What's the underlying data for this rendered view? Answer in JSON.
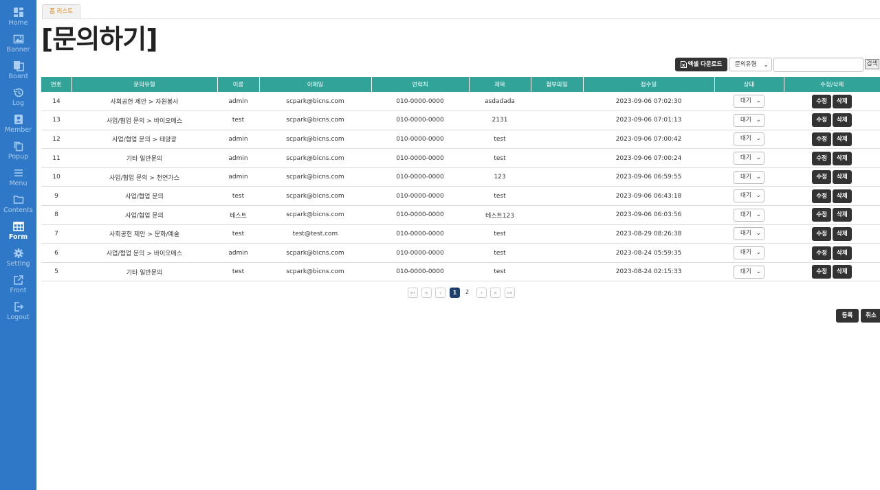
{
  "sidebar": {
    "items": [
      {
        "label": "Home",
        "icon": "dashboard-icon"
      },
      {
        "label": "Banner",
        "icon": "image-icon"
      },
      {
        "label": "Board",
        "icon": "board-icon"
      },
      {
        "label": "Log",
        "icon": "history-icon"
      },
      {
        "label": "Member",
        "icon": "member-icon"
      },
      {
        "label": "Popup",
        "icon": "copy-icon"
      },
      {
        "label": "Menu",
        "icon": "list-icon"
      },
      {
        "label": "Contents",
        "icon": "folder-icon"
      },
      {
        "label": "Form",
        "icon": "table-icon",
        "active": true
      },
      {
        "label": "Setting",
        "icon": "gear-icon"
      },
      {
        "label": "Front",
        "icon": "external-link-icon"
      },
      {
        "label": "Logout",
        "icon": "logout-icon"
      }
    ]
  },
  "tab": {
    "label": "폼 리스트"
  },
  "page": {
    "title": "[문의하기]"
  },
  "toolbar": {
    "excel_label": "엑셀 다운로드",
    "type_select": "문의유형",
    "search_value": "",
    "search_label": "검색"
  },
  "table": {
    "headers": [
      "번호",
      "문의유형",
      "이름",
      "이메일",
      "연락처",
      "제목",
      "첨부파일",
      "접수일",
      "상태",
      "수정/삭제"
    ],
    "rows": [
      {
        "no": "14",
        "type": "사회공헌 제안 > 자원봉사",
        "name": "admin",
        "email": "scpark@bicns.com",
        "phone": "010-0000-0000",
        "subject": "asdadada",
        "file": "",
        "date": "2023-09-06 07:02:30",
        "status": "대기"
      },
      {
        "no": "13",
        "type": "사업/협업 문의 > 바이오메스",
        "name": "test",
        "email": "scpark@bicns.com",
        "phone": "010-0000-0000",
        "subject": "2131",
        "file": "",
        "date": "2023-09-06 07:01:13",
        "status": "대기"
      },
      {
        "no": "12",
        "type": "사업/협업 문의 > 태양광",
        "name": "admin",
        "email": "scpark@bicns.com",
        "phone": "010-0000-0000",
        "subject": "test",
        "file": "",
        "date": "2023-09-06 07:00:42",
        "status": "대기"
      },
      {
        "no": "11",
        "type": "기타 일반문의",
        "name": "admin",
        "email": "scpark@bicns.com",
        "phone": "010-0000-0000",
        "subject": "test",
        "file": "",
        "date": "2023-09-06 07:00:24",
        "status": "대기"
      },
      {
        "no": "10",
        "type": "사업/협업 문의 > 천연가스",
        "name": "admin",
        "email": "scpark@bicns.com",
        "phone": "010-0000-0000",
        "subject": "123",
        "file": "",
        "date": "2023-09-06 06:59:55",
        "status": "대기"
      },
      {
        "no": "9",
        "type": "사업/협업 문의",
        "name": "test",
        "email": "scpark@bicns.com",
        "phone": "010-0000-0000",
        "subject": "test",
        "file": "",
        "date": "2023-09-06 06:43:18",
        "status": "대기"
      },
      {
        "no": "8",
        "type": "사업/협업 문의",
        "name": "테스트",
        "email": "scpark@bicns.com",
        "phone": "010-0000-0000",
        "subject": "테스트123",
        "file": "",
        "date": "2023-09-06 06:03:56",
        "status": "대기"
      },
      {
        "no": "7",
        "type": "사회공헌 제안 > 문화/예술",
        "name": "test",
        "email": "test@test.com",
        "phone": "010-0000-0000",
        "subject": "test",
        "file": "",
        "date": "2023-08-29 08:26:38",
        "status": "대기"
      },
      {
        "no": "6",
        "type": "사업/협업 문의 > 바이오메스",
        "name": "admin",
        "email": "scpark@bicns.com",
        "phone": "010-0000-0000",
        "subject": "test",
        "file": "",
        "date": "2023-08-24 05:59:35",
        "status": "대기"
      },
      {
        "no": "5",
        "type": "기타 일반문의",
        "name": "test",
        "email": "scpark@bicns.com",
        "phone": "010-0000-0000",
        "subject": "test",
        "file": "",
        "date": "2023-08-24 02:15:33",
        "status": "대기"
      }
    ],
    "edit_label": "수정",
    "delete_label": "삭제"
  },
  "pagination": {
    "first": "«‹",
    "prev_group": "«",
    "prev": "‹",
    "pages": [
      "1",
      "2"
    ],
    "current": "1",
    "next": "›",
    "next_group": "»",
    "last": "›»"
  },
  "footer": {
    "register_label": "등록",
    "cancel_label": "취소"
  }
}
